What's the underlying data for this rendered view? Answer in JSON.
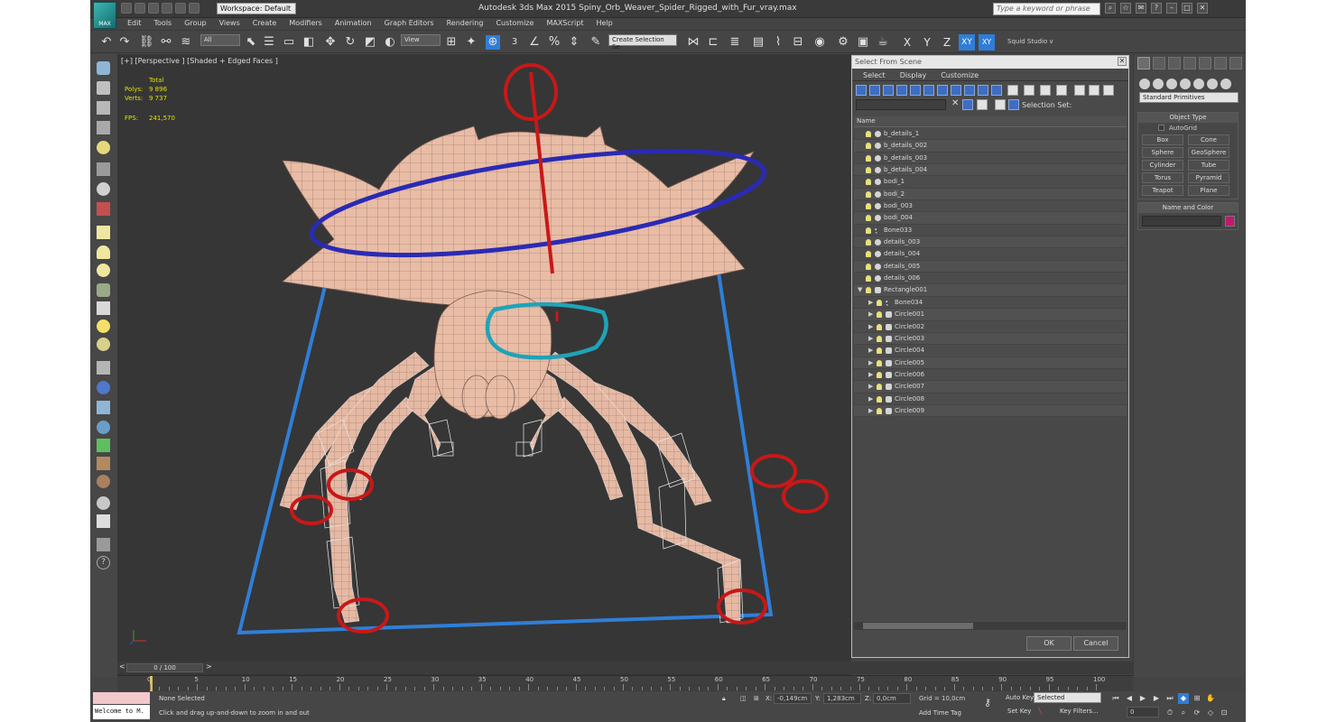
{
  "title_bar": {
    "app_logo_text": "MAX",
    "workspace": "Workspace: Default",
    "window_title": "Autodesk 3ds Max  2015    Spiny_Orb_Weaver_Spider_Rigged_with_Fur_vray.max",
    "search_placeholder": "Type a keyword or phrase",
    "window_buttons": [
      "–",
      "□",
      "✕"
    ]
  },
  "menu": [
    "Edit",
    "Tools",
    "Group",
    "Views",
    "Create",
    "Modifiers",
    "Animation",
    "Graph Editors",
    "Rendering",
    "Customize",
    "MAXScript",
    "Help"
  ],
  "toolbar": {
    "selection_filter": "All",
    "ref_coord": "View",
    "snap_label": "3",
    "named_selection": "Create Selection Se",
    "axes": [
      "X",
      "Y",
      "Z",
      "XY",
      "XY"
    ],
    "squid_label": "Squid Studio v"
  },
  "viewport": {
    "label": "[+] [Perspective ] [Shaded + Edged Faces ]",
    "stats": {
      "header": "Total",
      "polys_label": "Polys:",
      "polys_value": "9 896",
      "verts_label": "Verts:",
      "verts_value": "9 737",
      "fps_label": "FPS:",
      "fps_value": "241,570"
    }
  },
  "scene_dialog": {
    "title": "Select From Scene",
    "menu": [
      "Select",
      "Display",
      "Customize"
    ],
    "selection_set_label": "Selection Set:",
    "column_header": "Name",
    "items": [
      {
        "name": "b_details_1",
        "level": 0,
        "kind": "mesh"
      },
      {
        "name": "b_details_002",
        "level": 0,
        "kind": "mesh"
      },
      {
        "name": "b_details_003",
        "level": 0,
        "kind": "mesh"
      },
      {
        "name": "b_details_004",
        "level": 0,
        "kind": "mesh"
      },
      {
        "name": "bodi_1",
        "level": 0,
        "kind": "mesh"
      },
      {
        "name": "bodi_2",
        "level": 0,
        "kind": "mesh"
      },
      {
        "name": "bodi_003",
        "level": 0,
        "kind": "mesh"
      },
      {
        "name": "bodi_004",
        "level": 0,
        "kind": "mesh"
      },
      {
        "name": "Bone033",
        "level": 0,
        "kind": "bone"
      },
      {
        "name": "details_003",
        "level": 0,
        "kind": "mesh"
      },
      {
        "name": "details_004",
        "level": 0,
        "kind": "mesh"
      },
      {
        "name": "details_005",
        "level": 0,
        "kind": "mesh"
      },
      {
        "name": "details_006",
        "level": 0,
        "kind": "mesh"
      },
      {
        "name": "Rectangle001",
        "level": 0,
        "kind": "shape",
        "expanded": true
      },
      {
        "name": "Bone034",
        "level": 1,
        "kind": "bone"
      },
      {
        "name": "Circle001",
        "level": 1,
        "kind": "shape"
      },
      {
        "name": "Circle002",
        "level": 1,
        "kind": "shape"
      },
      {
        "name": "Circle003",
        "level": 1,
        "kind": "shape"
      },
      {
        "name": "Circle004",
        "level": 1,
        "kind": "shape"
      },
      {
        "name": "Circle005",
        "level": 1,
        "kind": "shape"
      },
      {
        "name": "Circle006",
        "level": 1,
        "kind": "shape"
      },
      {
        "name": "Circle007",
        "level": 1,
        "kind": "shape"
      },
      {
        "name": "Circle008",
        "level": 1,
        "kind": "shape"
      },
      {
        "name": "Circle009",
        "level": 1,
        "kind": "shape"
      }
    ],
    "ok_label": "OK",
    "cancel_label": "Cancel"
  },
  "command_panel": {
    "category_dropdown": "Standard Primitives",
    "object_type_title": "Object Type",
    "autogrid_label": "AutoGrid",
    "buttons": [
      "Box",
      "Cone",
      "Sphere",
      "GeoSphere",
      "Cylinder",
      "Tube",
      "Torus",
      "Pyramid",
      "Teapot",
      "Plane"
    ],
    "name_color_title": "Name and Color",
    "object_color": "#c2186b"
  },
  "timeline": {
    "frame_display": "0 / 100",
    "prev_label": "<",
    "next_label": ">",
    "ticks": [
      "0",
      "5",
      "10",
      "15",
      "20",
      "25",
      "30",
      "35",
      "40",
      "45",
      "50",
      "55",
      "60",
      "65",
      "70",
      "75",
      "80",
      "85",
      "90",
      "95",
      "100"
    ]
  },
  "status": {
    "listener_text": "Welcome to M.",
    "selection_status": "None Selected",
    "prompt": "Click and drag up-and-down to zoom in and out",
    "x_label": "X:",
    "x_value": "-0,149cm",
    "y_label": "Y:",
    "y_value": "1,283cm",
    "z_label": "Z:",
    "z_value": "0,0cm",
    "grid": "Grid = 10,0cm",
    "add_time_tag": "Add Time Tag",
    "auto_key": "Auto Key",
    "set_key": "Set Key",
    "key_mode": "Selected",
    "key_filters": "Key Filters...",
    "current_frame": "0"
  },
  "colors": {
    "rig_red": "#c81818",
    "rig_blue": "#2a2ab4",
    "rig_cyan": "#1fa3b8",
    "ground_rect": "#2f7fd8",
    "skin": "#e9bca6",
    "accent_blue": "#2f7dd8"
  }
}
